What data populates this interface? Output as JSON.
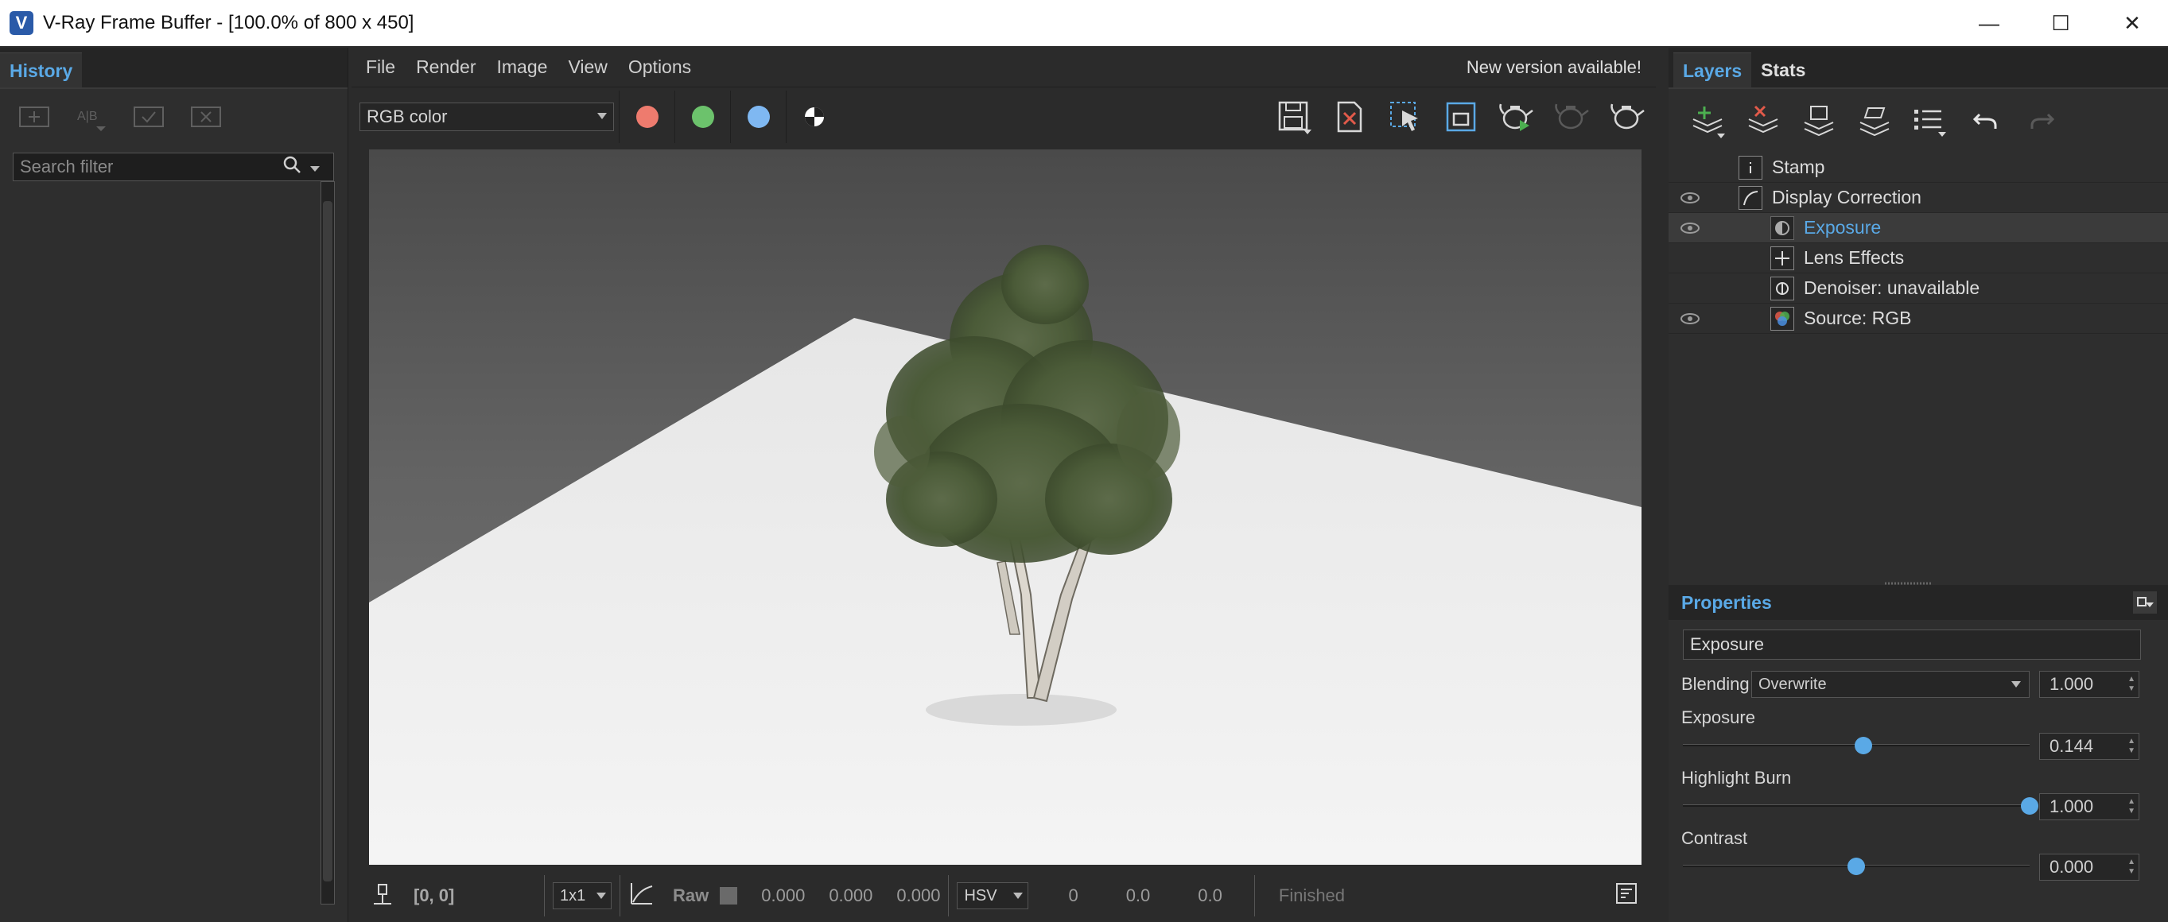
{
  "window": {
    "title": "V-Ray Frame Buffer - [100.0% of 800 x 450]",
    "app_icon_letter": "V"
  },
  "history": {
    "tab_label": "History",
    "search_placeholder": "Search filter"
  },
  "menu": {
    "items": [
      "File",
      "Render",
      "Image",
      "View",
      "Options"
    ],
    "notice": "New version available!"
  },
  "toolbar": {
    "channel": "RGB color",
    "colors": {
      "red": "#ee7b6e",
      "green": "#6cc26c",
      "blue": "#7fb8f2"
    }
  },
  "status": {
    "coords": "[0, 0]",
    "sampling": "1x1",
    "raw_label": "Raw",
    "rgb_values": [
      "0.000",
      "0.000",
      "0.000"
    ],
    "color_mode": "HSV",
    "hsv_values": [
      "0",
      "0.0",
      "0.0"
    ],
    "render_status": "Finished"
  },
  "right_tabs": [
    "Layers",
    "Stats"
  ],
  "layers": [
    {
      "name": "Stamp",
      "visible": false,
      "indent": 0,
      "selected": false
    },
    {
      "name": "Display Correction",
      "visible": true,
      "indent": 0,
      "selected": false
    },
    {
      "name": "Exposure",
      "visible": true,
      "indent": 1,
      "selected": true
    },
    {
      "name": "Lens Effects",
      "visible": false,
      "indent": 1,
      "selected": false
    },
    {
      "name": "Denoiser: unavailable",
      "visible": false,
      "indent": 1,
      "selected": false
    },
    {
      "name": "Source: RGB",
      "visible": true,
      "indent": 1,
      "selected": false
    }
  ],
  "properties": {
    "title": "Properties",
    "layer_name": "Exposure",
    "blending_label": "Blending",
    "blending_mode": "Overwrite",
    "blending_amount": "1.000",
    "exposure_label": "Exposure",
    "exposure_value": "0.144",
    "exposure_level": 0.52,
    "highlight_burn_label": "Highlight Burn",
    "highlight_burn_value": "1.000",
    "highlight_burn_level": 1.0,
    "contrast_label": "Contrast",
    "contrast_value": "0.000",
    "contrast_level": 0.5
  }
}
